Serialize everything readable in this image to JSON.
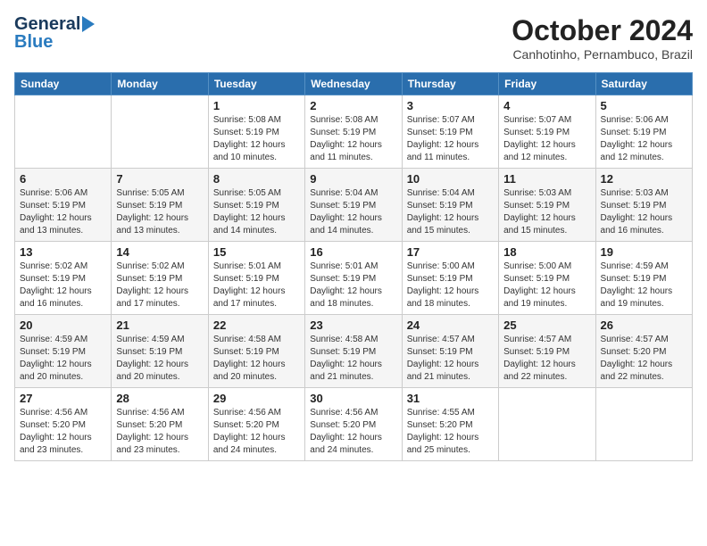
{
  "header": {
    "logo_general": "General",
    "logo_blue": "Blue",
    "title": "October 2024",
    "location": "Canhotinho, Pernambuco, Brazil"
  },
  "weekdays": [
    "Sunday",
    "Monday",
    "Tuesday",
    "Wednesday",
    "Thursday",
    "Friday",
    "Saturday"
  ],
  "weeks": [
    [
      {
        "day": "",
        "info": ""
      },
      {
        "day": "",
        "info": ""
      },
      {
        "day": "1",
        "info": "Sunrise: 5:08 AM\nSunset: 5:19 PM\nDaylight: 12 hours\nand 10 minutes."
      },
      {
        "day": "2",
        "info": "Sunrise: 5:08 AM\nSunset: 5:19 PM\nDaylight: 12 hours\nand 11 minutes."
      },
      {
        "day": "3",
        "info": "Sunrise: 5:07 AM\nSunset: 5:19 PM\nDaylight: 12 hours\nand 11 minutes."
      },
      {
        "day": "4",
        "info": "Sunrise: 5:07 AM\nSunset: 5:19 PM\nDaylight: 12 hours\nand 12 minutes."
      },
      {
        "day": "5",
        "info": "Sunrise: 5:06 AM\nSunset: 5:19 PM\nDaylight: 12 hours\nand 12 minutes."
      }
    ],
    [
      {
        "day": "6",
        "info": "Sunrise: 5:06 AM\nSunset: 5:19 PM\nDaylight: 12 hours\nand 13 minutes."
      },
      {
        "day": "7",
        "info": "Sunrise: 5:05 AM\nSunset: 5:19 PM\nDaylight: 12 hours\nand 13 minutes."
      },
      {
        "day": "8",
        "info": "Sunrise: 5:05 AM\nSunset: 5:19 PM\nDaylight: 12 hours\nand 14 minutes."
      },
      {
        "day": "9",
        "info": "Sunrise: 5:04 AM\nSunset: 5:19 PM\nDaylight: 12 hours\nand 14 minutes."
      },
      {
        "day": "10",
        "info": "Sunrise: 5:04 AM\nSunset: 5:19 PM\nDaylight: 12 hours\nand 15 minutes."
      },
      {
        "day": "11",
        "info": "Sunrise: 5:03 AM\nSunset: 5:19 PM\nDaylight: 12 hours\nand 15 minutes."
      },
      {
        "day": "12",
        "info": "Sunrise: 5:03 AM\nSunset: 5:19 PM\nDaylight: 12 hours\nand 16 minutes."
      }
    ],
    [
      {
        "day": "13",
        "info": "Sunrise: 5:02 AM\nSunset: 5:19 PM\nDaylight: 12 hours\nand 16 minutes."
      },
      {
        "day": "14",
        "info": "Sunrise: 5:02 AM\nSunset: 5:19 PM\nDaylight: 12 hours\nand 17 minutes."
      },
      {
        "day": "15",
        "info": "Sunrise: 5:01 AM\nSunset: 5:19 PM\nDaylight: 12 hours\nand 17 minutes."
      },
      {
        "day": "16",
        "info": "Sunrise: 5:01 AM\nSunset: 5:19 PM\nDaylight: 12 hours\nand 18 minutes."
      },
      {
        "day": "17",
        "info": "Sunrise: 5:00 AM\nSunset: 5:19 PM\nDaylight: 12 hours\nand 18 minutes."
      },
      {
        "day": "18",
        "info": "Sunrise: 5:00 AM\nSunset: 5:19 PM\nDaylight: 12 hours\nand 19 minutes."
      },
      {
        "day": "19",
        "info": "Sunrise: 4:59 AM\nSunset: 5:19 PM\nDaylight: 12 hours\nand 19 minutes."
      }
    ],
    [
      {
        "day": "20",
        "info": "Sunrise: 4:59 AM\nSunset: 5:19 PM\nDaylight: 12 hours\nand 20 minutes."
      },
      {
        "day": "21",
        "info": "Sunrise: 4:59 AM\nSunset: 5:19 PM\nDaylight: 12 hours\nand 20 minutes."
      },
      {
        "day": "22",
        "info": "Sunrise: 4:58 AM\nSunset: 5:19 PM\nDaylight: 12 hours\nand 20 minutes."
      },
      {
        "day": "23",
        "info": "Sunrise: 4:58 AM\nSunset: 5:19 PM\nDaylight: 12 hours\nand 21 minutes."
      },
      {
        "day": "24",
        "info": "Sunrise: 4:57 AM\nSunset: 5:19 PM\nDaylight: 12 hours\nand 21 minutes."
      },
      {
        "day": "25",
        "info": "Sunrise: 4:57 AM\nSunset: 5:19 PM\nDaylight: 12 hours\nand 22 minutes."
      },
      {
        "day": "26",
        "info": "Sunrise: 4:57 AM\nSunset: 5:20 PM\nDaylight: 12 hours\nand 22 minutes."
      }
    ],
    [
      {
        "day": "27",
        "info": "Sunrise: 4:56 AM\nSunset: 5:20 PM\nDaylight: 12 hours\nand 23 minutes."
      },
      {
        "day": "28",
        "info": "Sunrise: 4:56 AM\nSunset: 5:20 PM\nDaylight: 12 hours\nand 23 minutes."
      },
      {
        "day": "29",
        "info": "Sunrise: 4:56 AM\nSunset: 5:20 PM\nDaylight: 12 hours\nand 24 minutes."
      },
      {
        "day": "30",
        "info": "Sunrise: 4:56 AM\nSunset: 5:20 PM\nDaylight: 12 hours\nand 24 minutes."
      },
      {
        "day": "31",
        "info": "Sunrise: 4:55 AM\nSunset: 5:20 PM\nDaylight: 12 hours\nand 25 minutes."
      },
      {
        "day": "",
        "info": ""
      },
      {
        "day": "",
        "info": ""
      }
    ]
  ]
}
